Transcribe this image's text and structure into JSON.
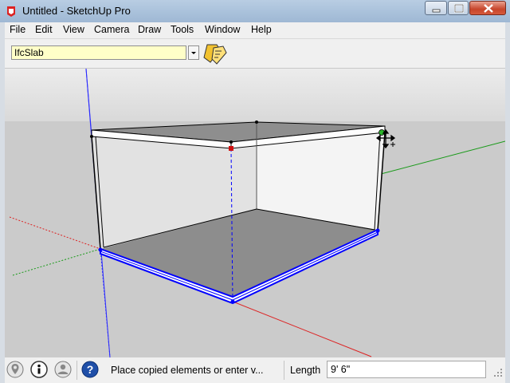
{
  "window": {
    "title": "Untitled - SketchUp Pro"
  },
  "menu": [
    "File",
    "Edit",
    "View",
    "Camera",
    "Draw",
    "Tools",
    "Window",
    "Help"
  ],
  "toolbar": {
    "layer_combo_value": "IfcSlab"
  },
  "status": {
    "message": "Place copied elements or enter v...",
    "measurement_label": "Length",
    "measurement_value": "9' 6\""
  },
  "icons": {
    "app": "sketchup-logo-icon",
    "tool": "move-copy-tool-icon",
    "geo": "geo-location-icon",
    "credits": "credits-icon",
    "user": "user-icon",
    "help": "help-icon"
  },
  "colors": {
    "title_bar": "#a8c0da",
    "sky": "#e3e3e3",
    "ground": "#c9c9c9",
    "selection": "#0000ff",
    "combo_bg": "#ffffc8"
  }
}
